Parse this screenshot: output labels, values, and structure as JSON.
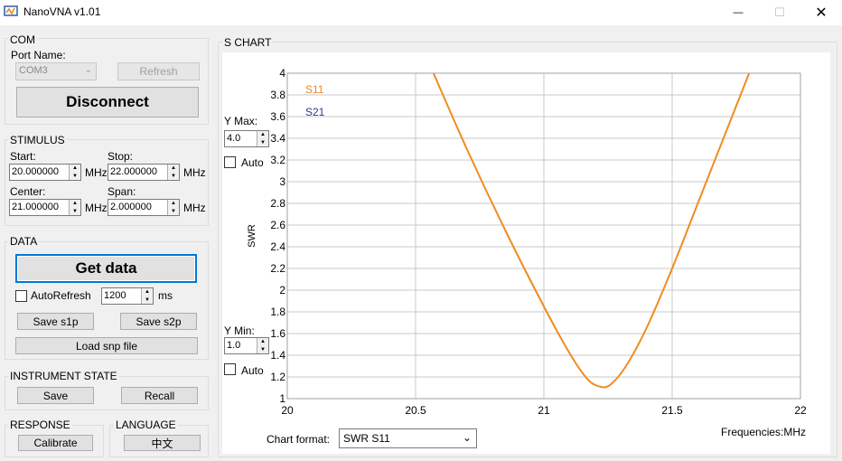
{
  "window": {
    "title": "NanoVNA v1.01",
    "minimize": "—",
    "maximize": "☐",
    "close": "✕"
  },
  "com": {
    "group_label": "COM",
    "port_label": "Port Name:",
    "port_value": "COM3",
    "refresh": "Refresh",
    "disconnect": "Disconnect"
  },
  "stimulus": {
    "group_label": "STIMULUS",
    "start_label": "Start:",
    "start_value": "20.000000",
    "stop_label": "Stop:",
    "stop_value": "22.000000",
    "center_label": "Center:",
    "center_value": "21.000000",
    "span_label": "Span:",
    "span_value": "2.000000",
    "unit": "MHz"
  },
  "data_group": {
    "group_label": "DATA",
    "get_data": "Get data",
    "autorefresh": "AutoRefresh",
    "interval": "1200",
    "interval_unit": "ms",
    "save_s1p": "Save s1p",
    "save_s2p": "Save s2p",
    "load_snp": "Load snp file"
  },
  "instrument": {
    "group_label": "INSTRUMENT STATE",
    "save": "Save",
    "recall": "Recall"
  },
  "response": {
    "group_label": "RESPONSE",
    "calibrate": "Calibrate"
  },
  "language": {
    "group_label": "LANGUAGE",
    "button": "中文"
  },
  "schart": {
    "group_label": "S CHART",
    "ymax_label": "Y Max:",
    "ymax_value": "4.0",
    "ymax_auto": "Auto",
    "ymin_label": "Y Min:",
    "ymin_value": "1.0",
    "ymin_auto": "Auto",
    "format_label": "Chart format:",
    "format_value": "SWR S11",
    "freq_label": "Frequencies:MHz"
  },
  "colors": {
    "s11": "#f08c1e",
    "s21": "#2d3a8c",
    "grid": "#c8c8c8"
  },
  "chart_data": {
    "type": "line",
    "xlabel": "Frequencies:MHz",
    "ylabel": "SWR",
    "xlim": [
      20,
      22
    ],
    "ylim": [
      1,
      4
    ],
    "xticks": [
      "20",
      "20.5",
      "21",
      "21.5",
      "22"
    ],
    "yticks": [
      "1",
      "1.2",
      "1.4",
      "1.6",
      "1.8",
      "2",
      "2.2",
      "2.4",
      "2.6",
      "2.8",
      "3",
      "3.2",
      "3.4",
      "3.6",
      "3.8",
      "4"
    ],
    "series": [
      {
        "name": "S11",
        "x": [
          20.57,
          20.7,
          20.85,
          21.0,
          21.1,
          21.17,
          21.22,
          21.26,
          21.32,
          21.4,
          21.5,
          21.6,
          21.7,
          21.8
        ],
        "y": [
          4.0,
          3.3,
          2.55,
          1.85,
          1.42,
          1.18,
          1.11,
          1.13,
          1.3,
          1.65,
          2.2,
          2.8,
          3.4,
          4.0
        ]
      },
      {
        "name": "S21",
        "x": [],
        "y": []
      }
    ]
  }
}
